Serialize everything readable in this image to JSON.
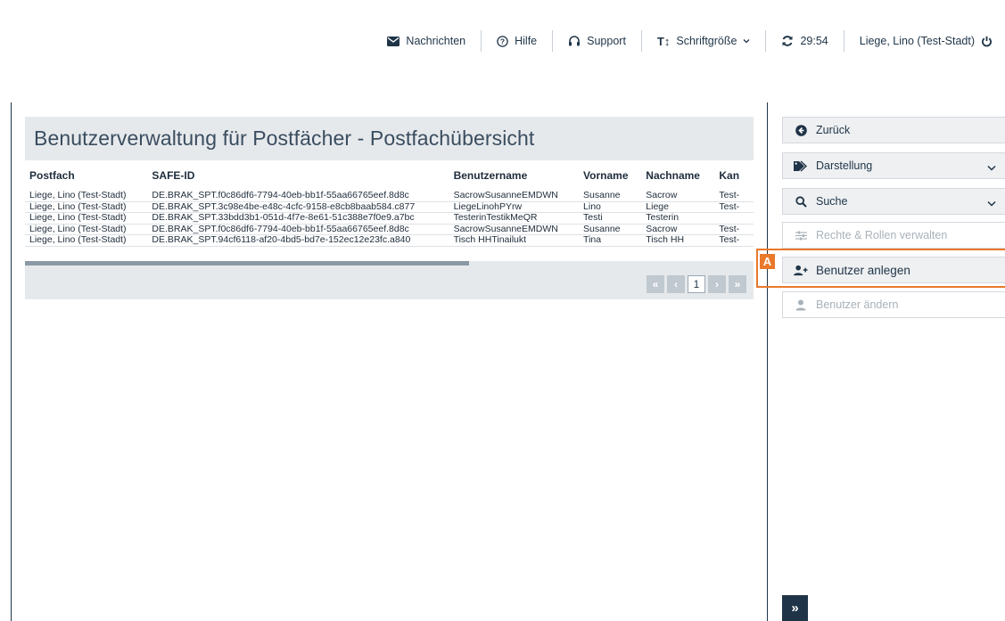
{
  "topbar": {
    "messages": "Nachrichten",
    "help": "Hilfe",
    "support": "Support",
    "fontsize": "Schriftgröße",
    "timer": "29:54",
    "user": "Liege, Lino (Test-Stadt)"
  },
  "panel": {
    "title": "Benutzerverwaltung für Postfächer - Postfachübersicht",
    "columns": [
      "Postfach",
      "SAFE-ID",
      "Benutzername",
      "Vorname",
      "Nachname",
      "Kan"
    ],
    "rows": [
      [
        "Liege, Lino (Test-Stadt)",
        "DE.BRAK_SPT.f0c86df6-7794-40eb-bb1f-55aa66765eef.8d8c",
        "SacrowSusanneEMDWN",
        "Susanne",
        "Sacrow",
        "Test-"
      ],
      [
        "Liege, Lino (Test-Stadt)",
        "DE.BRAK_SPT.3c98e4be-e48c-4cfc-9158-e8cb8baab584.c877",
        "LiegeLinohPYrw",
        "Lino",
        "Liege",
        "Test-"
      ],
      [
        "Liege, Lino (Test-Stadt)",
        "DE.BRAK_SPT.33bdd3b1-051d-4f7e-8e61-51c388e7f0e9.a7bc",
        "TesterinTestikMeQR",
        "Testi",
        "Testerin",
        ""
      ],
      [
        "Liege, Lino (Test-Stadt)",
        "DE.BRAK_SPT.f0c86df6-7794-40eb-bb1f-55aa66765eef.8d8c",
        "SacrowSusanneEMDWN",
        "Susanne",
        "Sacrow",
        "Test-"
      ],
      [
        "Liege, Lino (Test-Stadt)",
        "DE.BRAK_SPT.94cf6118-af20-4bd5-bd7e-152ec12e23fc.a840",
        "Tisch HHTinailukt",
        "Tina",
        "Tisch HH",
        "Test-"
      ]
    ],
    "pager": {
      "first": "«",
      "prev": "‹",
      "current": "1",
      "next": "›",
      "last": "»"
    }
  },
  "sidebar": {
    "back": "Zurück",
    "display": "Darstellung",
    "search": "Suche",
    "rights": "Rechte & Rollen verwalten",
    "create_user": "Benutzer anlegen",
    "edit_user": "Benutzer ändern",
    "expand": "»"
  },
  "annotation": {
    "tag": "A"
  },
  "colors": {
    "accent": "#e9792b",
    "primary": "#1f3447",
    "panel": "#e6e9ec"
  }
}
